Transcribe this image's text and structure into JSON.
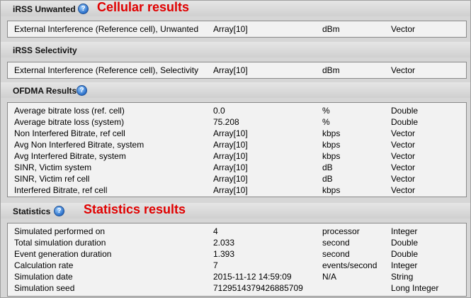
{
  "sections": [
    {
      "title": "iRSS Unwanted",
      "annotation": "Cellular results",
      "rows": [
        [
          "External Interference (Reference cell), Unwanted",
          "Array[10]",
          "dBm",
          "Vector"
        ]
      ]
    },
    {
      "title": "iRSS Selectivity",
      "rows": [
        [
          "External Interference (Reference cell), Selectivity",
          "Array[10]",
          "dBm",
          "Vector"
        ]
      ]
    },
    {
      "title": "OFDMA Results",
      "rows": [
        [
          "Average bitrate loss (ref. cell)",
          "0.0",
          "%",
          "Double"
        ],
        [
          "Average bitrate loss (system)",
          "75.208",
          "%",
          "Double"
        ],
        [
          "Non Interfered Bitrate, ref cell",
          "Array[10]",
          "kbps",
          "Vector"
        ],
        [
          "Avg Non Interfered Bitrate, system",
          "Array[10]",
          "kbps",
          "Vector"
        ],
        [
          "Avg Interfered Bitrate, system",
          "Array[10]",
          "kbps",
          "Vector"
        ],
        [
          "SINR, Victim system",
          "Array[10]",
          "dB",
          "Vector"
        ],
        [
          "SINR, Victim ref cell",
          "Array[10]",
          "dB",
          "Vector"
        ],
        [
          "Interfered Bitrate, ref cell",
          "Array[10]",
          "kbps",
          "Vector"
        ]
      ]
    },
    {
      "title": "Statistics",
      "annotation": "Statistics results",
      "rows": [
        [
          "Simulated performed on",
          "4",
          "processor",
          "Integer"
        ],
        [
          "Total simulation duration",
          "2.033",
          "second",
          "Double"
        ],
        [
          "Event generation duration",
          "1.393",
          "second",
          "Double"
        ],
        [
          "Calculation rate",
          "7",
          "events/second",
          "Integer"
        ],
        [
          "Simulation date",
          "2015-11-12 14:59:09",
          "N/A",
          "String"
        ],
        [
          "Simulation seed",
          "7129514379426885709",
          "",
          "Long Integer"
        ]
      ]
    }
  ],
  "help_icon_glyph": "?",
  "colors": {
    "annotation": "#e00000",
    "help_icon": "#2a6fc9",
    "panel_bg": "#f2f2f2",
    "section_bg": "#d6d6d6"
  }
}
